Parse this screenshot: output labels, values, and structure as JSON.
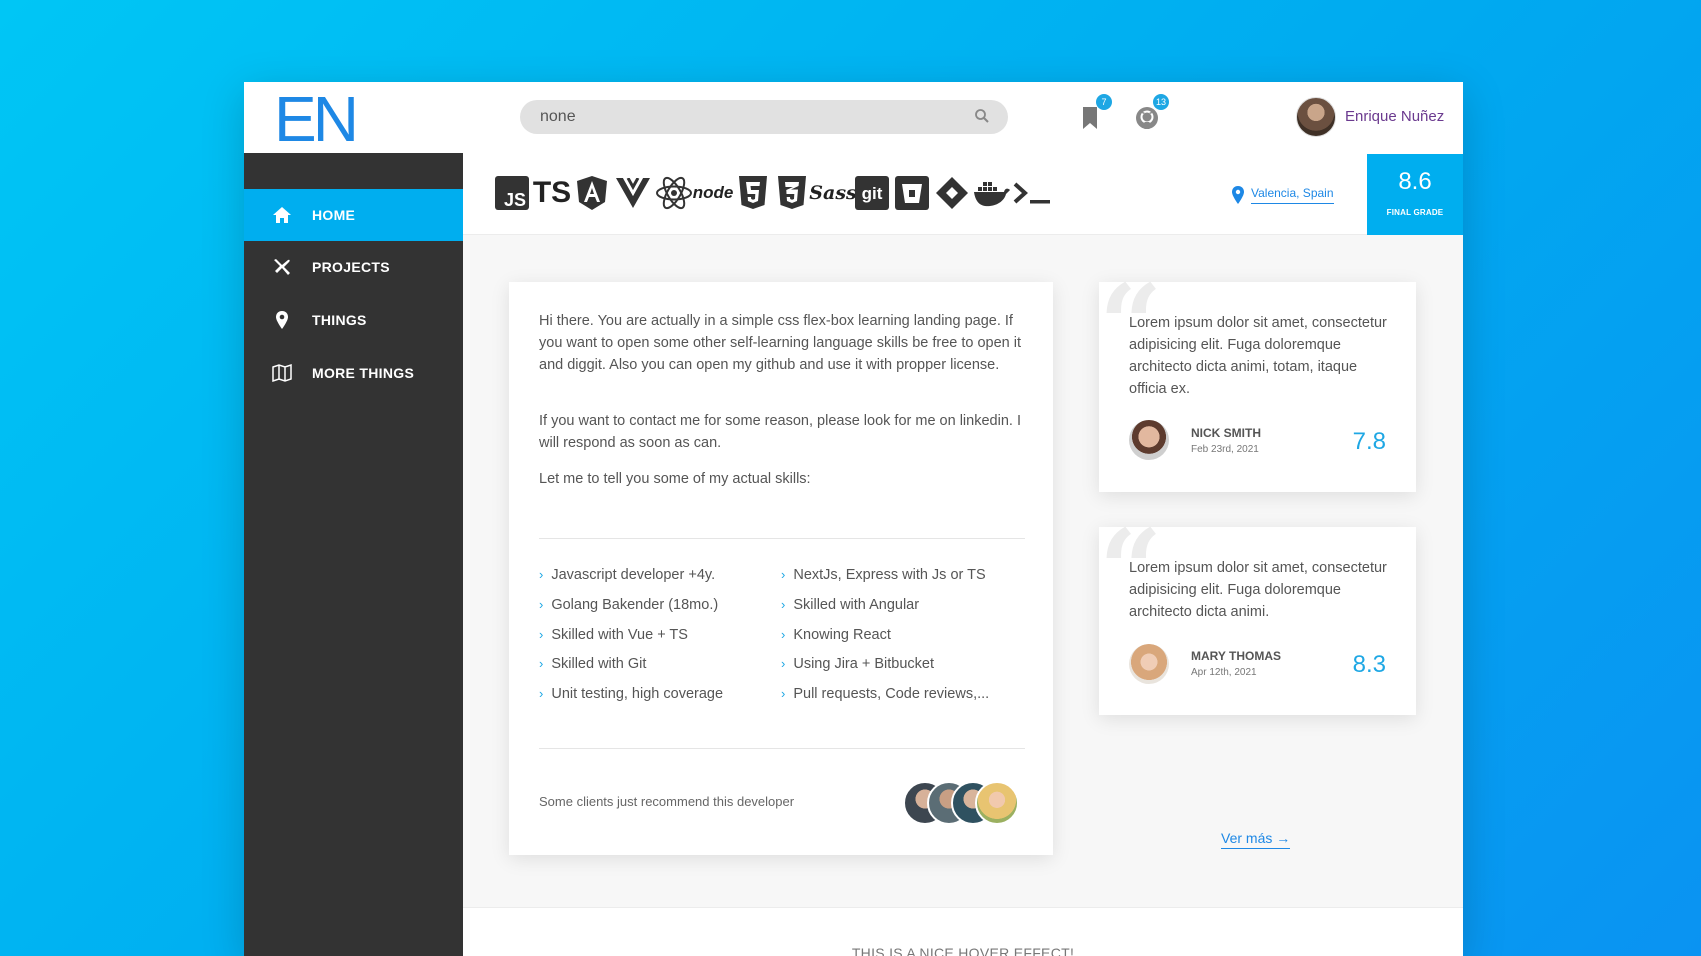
{
  "header": {
    "logo": "EN",
    "search": {
      "value": "none",
      "placeholder": ""
    },
    "bookmarks_badge": "7",
    "github_badge": "13",
    "username": "Enrique Nuñez"
  },
  "sidebar": {
    "items": [
      {
        "label": "HOME",
        "icon": "home-icon",
        "active": true
      },
      {
        "label": "PROJECTS",
        "icon": "plane-icon",
        "active": false
      },
      {
        "label": "THINGS",
        "icon": "location-pin-icon",
        "active": false
      },
      {
        "label": "MORE THINGS",
        "icon": "map-icon",
        "active": false
      }
    ]
  },
  "tech_stack": [
    "JS",
    "TS",
    "Angular",
    "Vue",
    "React",
    "node",
    "HTML5",
    "CSS3",
    "Sass",
    "git",
    "Bitbucket",
    "Jira",
    "Docker",
    "Terminal"
  ],
  "location": "Valencia, Spain",
  "grade": {
    "value": "8.6",
    "label": "FINAL GRADE"
  },
  "main_card": {
    "intro": "Hi there. You are actually in a simple css flex-box learning landing page. If you want to open some other self-learning language skills be free to open it and diggit. Also you can open my github and use it with propper license.",
    "contact": "If you want to contact me for some reason, please look for me on linkedin. I will respond as soon as can.",
    "skills_intro": "Let me to tell you some of my actual skills:",
    "skills_left": [
      "Javascript developer +4y.",
      "Golang Bakender (18mo.)",
      "Skilled with Vue + TS",
      "Skilled with Git",
      "Unit testing, high coverage"
    ],
    "skills_right": [
      "NextJs, Express with Js or TS",
      "Skilled with Angular",
      "Knowing React",
      "Using Jira + Bitbucket",
      "Pull requests, Code reviews,..."
    ],
    "recommend_text": "Some clients just recommend this developer"
  },
  "reviews": [
    {
      "text": "Lorem ipsum dolor sit amet, consectetur adipisicing elit. Fuga doloremque architecto dicta animi, totam, itaque officia ex.",
      "name": "NICK SMITH",
      "date": "Feb 23rd, 2021",
      "score": "7.8"
    },
    {
      "text": "Lorem ipsum dolor sit amet, consectetur adipisicing elit. Fuga doloremque architecto dicta animi.",
      "name": "MARY THOMAS",
      "date": "Apr 12th, 2021",
      "score": "8.3"
    }
  ],
  "ver_mas": "Ver más →",
  "footer": "THIS IS A NICE HOVER EFFECT!",
  "colors": {
    "accent": "#00aeef",
    "sidebar": "#333333",
    "link": "#1e88e5",
    "username": "#6b3a8f"
  }
}
